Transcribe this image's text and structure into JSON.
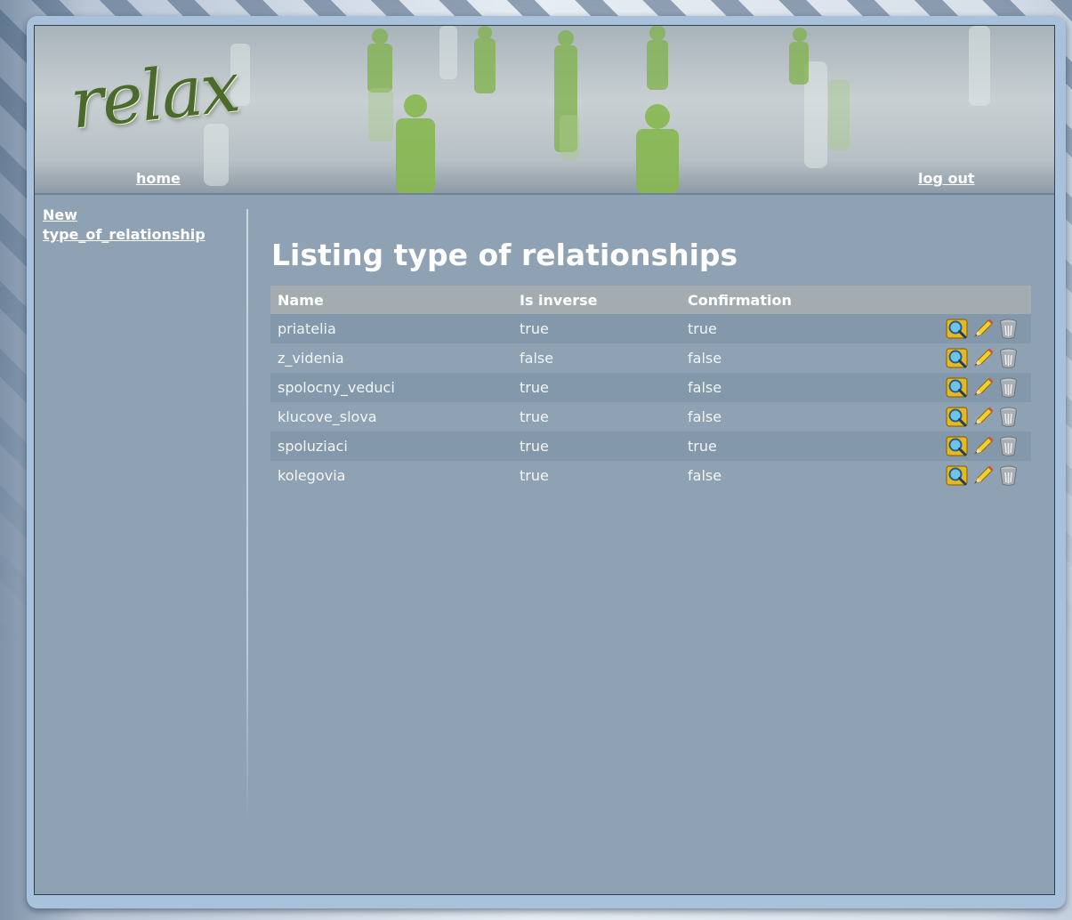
{
  "app": {
    "logo_text": "relax"
  },
  "nav": {
    "home": "home",
    "logout": "log out"
  },
  "sidebar": {
    "new_link_line1": "New",
    "new_link_line2": "type_of_relationship"
  },
  "main": {
    "title": "Listing type of relationships",
    "columns": [
      "Name",
      "Is inverse",
      "Confirmation"
    ],
    "rows": [
      {
        "name": "priatelia",
        "is_inverse": "true",
        "confirmation": "true"
      },
      {
        "name": "z_videnia",
        "is_inverse": "false",
        "confirmation": "false"
      },
      {
        "name": "spolocny_veduci",
        "is_inverse": "true",
        "confirmation": "false"
      },
      {
        "name": "klucove_slova",
        "is_inverse": "true",
        "confirmation": "false"
      },
      {
        "name": "spoluziaci",
        "is_inverse": "true",
        "confirmation": "true"
      },
      {
        "name": "kolegovia",
        "is_inverse": "true",
        "confirmation": "false"
      }
    ],
    "row_actions": [
      "show-icon",
      "edit-pencil-icon",
      "delete-trash-icon"
    ]
  },
  "colors": {
    "content_bg": "#8ea2b4",
    "row_alt": "#8398aa",
    "header_row": "#a5acb1",
    "logo_green": "#4a6b2c",
    "figure_green": "#7fb24a"
  }
}
